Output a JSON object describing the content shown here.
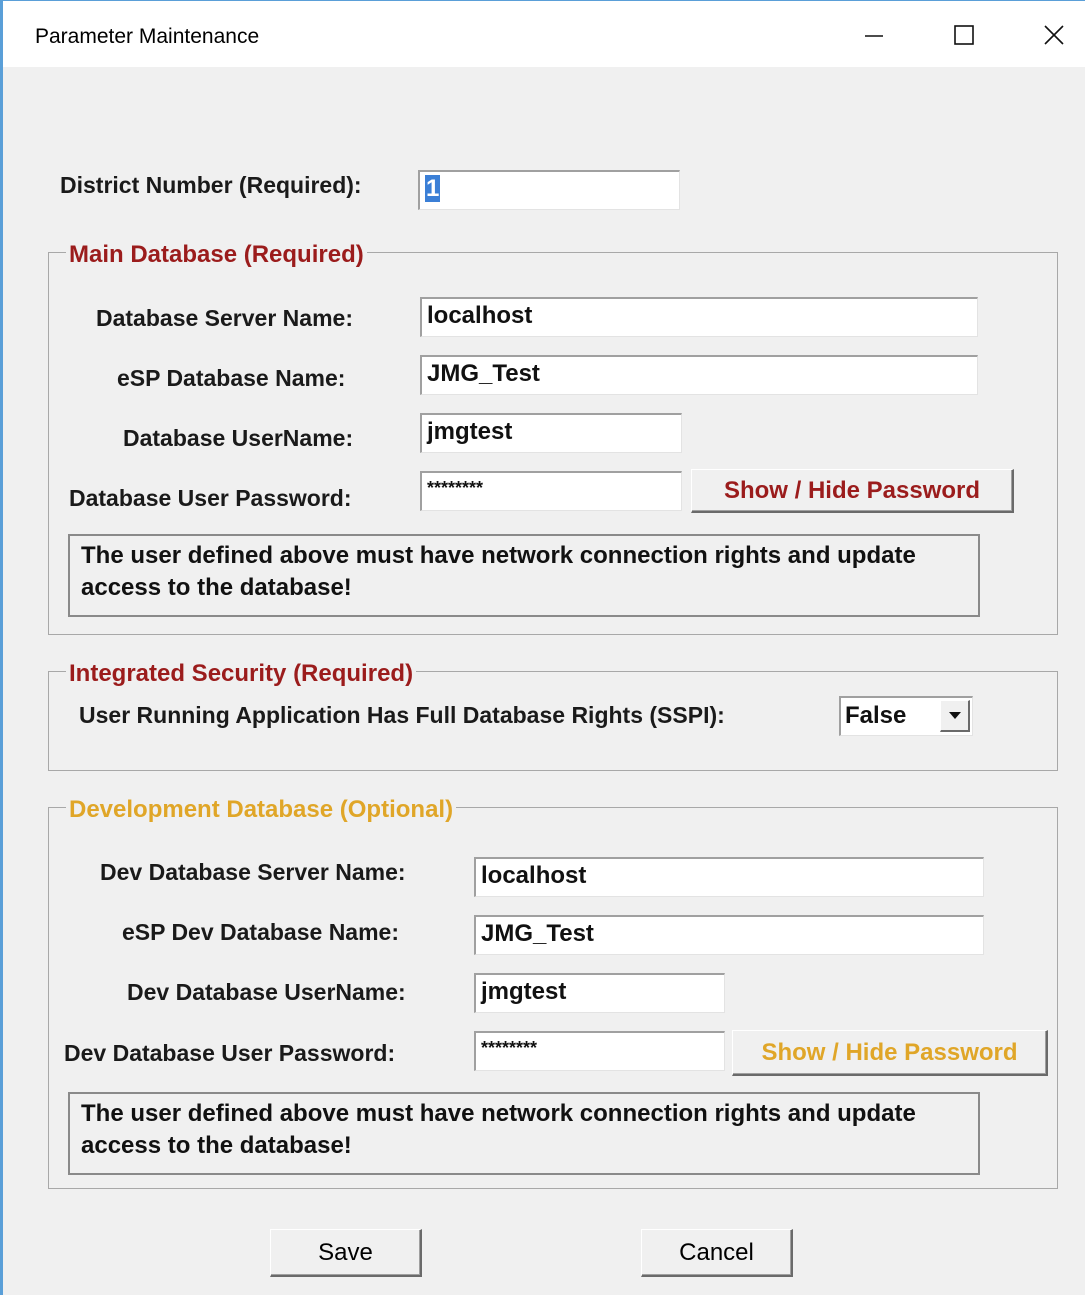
{
  "window": {
    "title": "Parameter Maintenance",
    "controls": [
      "minimize-icon",
      "maximize-icon",
      "close-icon"
    ]
  },
  "district": {
    "label": "District Number (Required):",
    "value": "1"
  },
  "main_db": {
    "title": "Main Database (Required)",
    "title_color": "#9b1c1c",
    "server_label": "Database Server Name:",
    "server_value": "localhost",
    "db_label": "eSP Database Name:",
    "db_value": "JMG_Test",
    "user_label": "Database UserName:",
    "user_value": "jmgtest",
    "password_label": "Database User Password:",
    "password_value": "********",
    "toggle_label": "Show / Hide Password",
    "note": "The user defined above must have network connection rights and update access to the database!"
  },
  "security": {
    "title": "Integrated Security (Required)",
    "title_color": "#9b1c1c",
    "sspi_label": "User Running Application Has Full Database Rights (SSPI):",
    "sspi_value": "False"
  },
  "dev_db": {
    "title": "Development Database (Optional)",
    "title_color": "#e0a628",
    "server_label": "Dev Database Server Name:",
    "server_value": "localhost",
    "db_label": "eSP Dev Database Name:",
    "db_value": "JMG_Test",
    "user_label": "Dev Database UserName:",
    "user_value": "jmgtest",
    "password_label": "Dev Database User Password:",
    "password_value": "********",
    "toggle_label": "Show / Hide Password",
    "note": "The user defined above must have network connection rights and update access to the database!"
  },
  "footer": {
    "save_label": "Save",
    "cancel_label": "Cancel"
  }
}
